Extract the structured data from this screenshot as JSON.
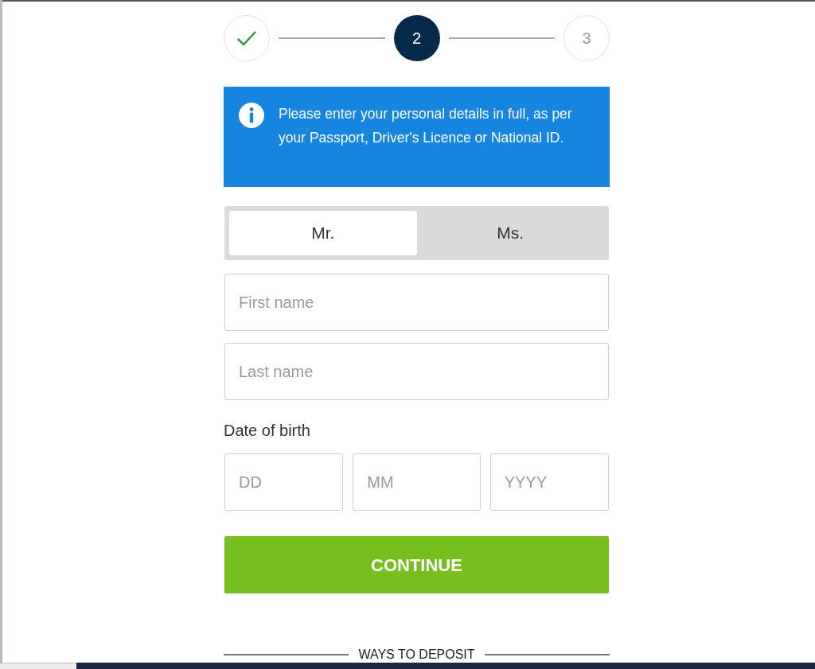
{
  "steps": [
    {
      "kind": "done"
    },
    {
      "kind": "current",
      "label": "2"
    },
    {
      "kind": "upcoming",
      "label": "3"
    }
  ],
  "notice": {
    "text": "Please enter your personal details in full, as per your Passport, Driver's Licence or National ID."
  },
  "title_options": [
    {
      "label": "Mr.",
      "selected": true
    },
    {
      "label": "Ms.",
      "selected": false
    }
  ],
  "first_name": {
    "placeholder": "First name"
  },
  "last_name": {
    "placeholder": "Last name"
  },
  "date_of_birth": {
    "label": "Date of birth",
    "fields": [
      {
        "placeholder": "DD"
      },
      {
        "placeholder": "MM"
      },
      {
        "placeholder": "YYYY"
      }
    ]
  },
  "continue_button": "CONTINUE",
  "ways_to_deposit": "WAYS TO DEPOSIT"
}
